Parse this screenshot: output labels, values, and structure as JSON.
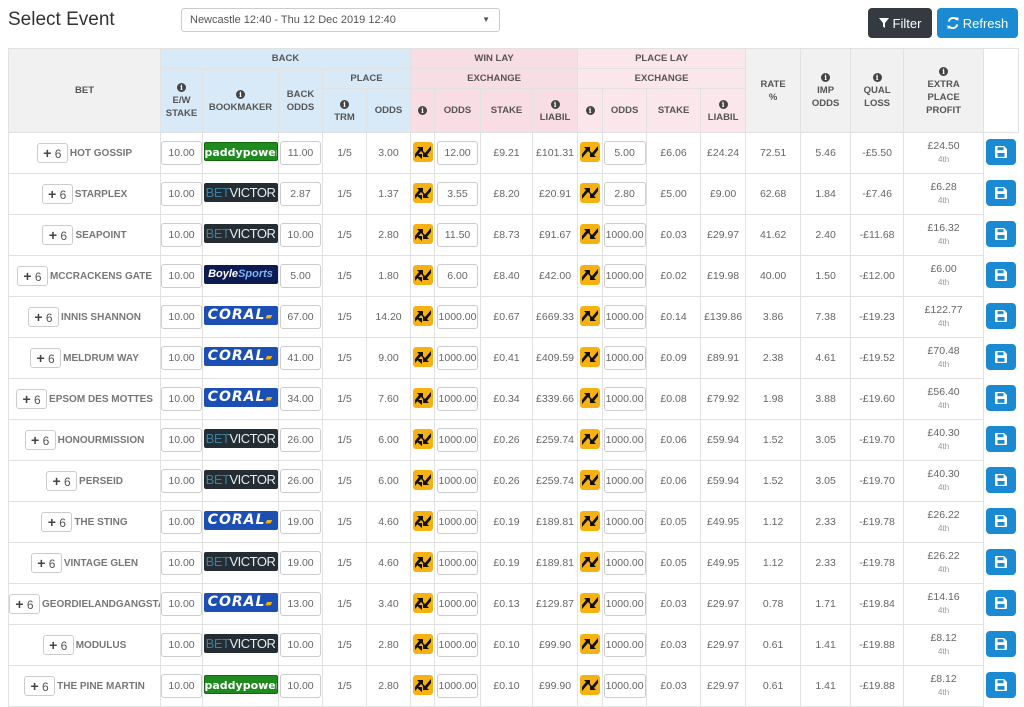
{
  "header": {
    "title": "Select Event",
    "event_select_value": "Newcastle 12:40 - Thu 12 Dec 2019 12:40",
    "filter_label": "Filter",
    "refresh_label": "Refresh"
  },
  "colors": {
    "back_header": "#d8eaf8",
    "win_lay_header": "#f9dde4",
    "place_lay_header": "#fbe6eb",
    "primary_button": "#1a8ad2",
    "dark_button": "#343a40",
    "swap_icon": "#f6b213"
  },
  "table": {
    "groups": {
      "back": "BACK",
      "place": "PLACE",
      "win_lay": "WIN LAY",
      "place_lay": "PLACE LAY",
      "exchange": "EXCHANGE"
    },
    "columns": {
      "bet": "BET",
      "ew_stake_1": "E/W",
      "ew_stake_2": "STAKE",
      "bookmaker": "BOOKMAKER",
      "back_odds_1": "BACK",
      "back_odds_2": "ODDS",
      "trm": "TRM",
      "odds": "ODDS",
      "stake": "STAKE",
      "liabil": "LIABIL",
      "rate_1": "RATE",
      "rate_2": "%",
      "imp_1": "IMP",
      "imp_2": "ODDS",
      "qual_1": "QUAL",
      "qual_2": "LOSS",
      "extra_1": "EXTRA",
      "extra_2": "PLACE",
      "extra_3": "PROFIT"
    },
    "info_glyph": "i",
    "rows": [
      {
        "places": "6",
        "horse": "HOT GOSSIP",
        "ew_stake": "10.00",
        "bookmaker": "paddypower",
        "back_odds": "11.00",
        "trm": "1/5",
        "place_odds": "3.00",
        "win_lay_odds": "12.00",
        "win_lay_stake": "£9.21",
        "win_lay_liabil": "£101.31",
        "place_lay_odds": "5.00",
        "place_lay_stake": "£6.06",
        "place_lay_liabil": "£24.24",
        "rate": "72.51",
        "imp_odds": "5.46",
        "qual_loss": "-£5.50",
        "extra_profit": "£24.50",
        "extra_place": "4th"
      },
      {
        "places": "6",
        "horse": "STARPLEX",
        "ew_stake": "10.00",
        "bookmaker": "betvictor",
        "back_odds": "2.87",
        "trm": "1/5",
        "place_odds": "1.37",
        "win_lay_odds": "3.55",
        "win_lay_stake": "£8.20",
        "win_lay_liabil": "£20.91",
        "place_lay_odds": "2.80",
        "place_lay_stake": "£5.00",
        "place_lay_liabil": "£9.00",
        "rate": "62.68",
        "imp_odds": "1.84",
        "qual_loss": "-£7.46",
        "extra_profit": "£6.28",
        "extra_place": "4th"
      },
      {
        "places": "6",
        "horse": "SEAPOINT",
        "ew_stake": "10.00",
        "bookmaker": "betvictor",
        "back_odds": "10.00",
        "trm": "1/5",
        "place_odds": "2.80",
        "win_lay_odds": "11.50",
        "win_lay_stake": "£8.73",
        "win_lay_liabil": "£91.67",
        "place_lay_odds": "1000.00",
        "place_lay_stake": "£0.03",
        "place_lay_liabil": "£29.97",
        "rate": "41.62",
        "imp_odds": "2.40",
        "qual_loss": "-£11.68",
        "extra_profit": "£16.32",
        "extra_place": "4th"
      },
      {
        "places": "6",
        "horse": "MCCRACKENS GATE",
        "ew_stake": "10.00",
        "bookmaker": "boylesports",
        "back_odds": "5.00",
        "trm": "1/5",
        "place_odds": "1.80",
        "win_lay_odds": "6.00",
        "win_lay_stake": "£8.40",
        "win_lay_liabil": "£42.00",
        "place_lay_odds": "1000.00",
        "place_lay_stake": "£0.02",
        "place_lay_liabil": "£19.98",
        "rate": "40.00",
        "imp_odds": "1.50",
        "qual_loss": "-£12.00",
        "extra_profit": "£6.00",
        "extra_place": "4th"
      },
      {
        "places": "6",
        "horse": "INNIS SHANNON",
        "ew_stake": "10.00",
        "bookmaker": "coral",
        "back_odds": "67.00",
        "trm": "1/5",
        "place_odds": "14.20",
        "win_lay_odds": "1000.00",
        "win_lay_stake": "£0.67",
        "win_lay_liabil": "£669.33",
        "place_lay_odds": "1000.00",
        "place_lay_stake": "£0.14",
        "place_lay_liabil": "£139.86",
        "rate": "3.86",
        "imp_odds": "7.38",
        "qual_loss": "-£19.23",
        "extra_profit": "£122.77",
        "extra_place": "4th"
      },
      {
        "places": "6",
        "horse": "MELDRUM WAY",
        "ew_stake": "10.00",
        "bookmaker": "coral",
        "back_odds": "41.00",
        "trm": "1/5",
        "place_odds": "9.00",
        "win_lay_odds": "1000.00",
        "win_lay_stake": "£0.41",
        "win_lay_liabil": "£409.59",
        "place_lay_odds": "1000.00",
        "place_lay_stake": "£0.09",
        "place_lay_liabil": "£89.91",
        "rate": "2.38",
        "imp_odds": "4.61",
        "qual_loss": "-£19.52",
        "extra_profit": "£70.48",
        "extra_place": "4th"
      },
      {
        "places": "6",
        "horse": "EPSOM DES MOTTES",
        "ew_stake": "10.00",
        "bookmaker": "coral",
        "back_odds": "34.00",
        "trm": "1/5",
        "place_odds": "7.60",
        "win_lay_odds": "1000.00",
        "win_lay_stake": "£0.34",
        "win_lay_liabil": "£339.66",
        "place_lay_odds": "1000.00",
        "place_lay_stake": "£0.08",
        "place_lay_liabil": "£79.92",
        "rate": "1.98",
        "imp_odds": "3.88",
        "qual_loss": "-£19.60",
        "extra_profit": "£56.40",
        "extra_place": "4th"
      },
      {
        "places": "6",
        "horse": "HONOURMISSION",
        "ew_stake": "10.00",
        "bookmaker": "betvictor",
        "back_odds": "26.00",
        "trm": "1/5",
        "place_odds": "6.00",
        "win_lay_odds": "1000.00",
        "win_lay_stake": "£0.26",
        "win_lay_liabil": "£259.74",
        "place_lay_odds": "1000.00",
        "place_lay_stake": "£0.06",
        "place_lay_liabil": "£59.94",
        "rate": "1.52",
        "imp_odds": "3.05",
        "qual_loss": "-£19.70",
        "extra_profit": "£40.30",
        "extra_place": "4th"
      },
      {
        "places": "6",
        "horse": "PERSEID",
        "ew_stake": "10.00",
        "bookmaker": "betvictor",
        "back_odds": "26.00",
        "trm": "1/5",
        "place_odds": "6.00",
        "win_lay_odds": "1000.00",
        "win_lay_stake": "£0.26",
        "win_lay_liabil": "£259.74",
        "place_lay_odds": "1000.00",
        "place_lay_stake": "£0.06",
        "place_lay_liabil": "£59.94",
        "rate": "1.52",
        "imp_odds": "3.05",
        "qual_loss": "-£19.70",
        "extra_profit": "£40.30",
        "extra_place": "4th"
      },
      {
        "places": "6",
        "horse": "THE STING",
        "ew_stake": "10.00",
        "bookmaker": "coral",
        "back_odds": "19.00",
        "trm": "1/5",
        "place_odds": "4.60",
        "win_lay_odds": "1000.00",
        "win_lay_stake": "£0.19",
        "win_lay_liabil": "£189.81",
        "place_lay_odds": "1000.00",
        "place_lay_stake": "£0.05",
        "place_lay_liabil": "£49.95",
        "rate": "1.12",
        "imp_odds": "2.33",
        "qual_loss": "-£19.78",
        "extra_profit": "£26.22",
        "extra_place": "4th"
      },
      {
        "places": "6",
        "horse": "VINTAGE GLEN",
        "ew_stake": "10.00",
        "bookmaker": "betvictor",
        "back_odds": "19.00",
        "trm": "1/5",
        "place_odds": "4.60",
        "win_lay_odds": "1000.00",
        "win_lay_stake": "£0.19",
        "win_lay_liabil": "£189.81",
        "place_lay_odds": "1000.00",
        "place_lay_stake": "£0.05",
        "place_lay_liabil": "£49.95",
        "rate": "1.12",
        "imp_odds": "2.33",
        "qual_loss": "-£19.78",
        "extra_profit": "£26.22",
        "extra_place": "4th"
      },
      {
        "places": "6",
        "horse": "GEORDIELANDGANGSTA",
        "ew_stake": "10.00",
        "bookmaker": "coral",
        "back_odds": "13.00",
        "trm": "1/5",
        "place_odds": "3.40",
        "win_lay_odds": "1000.00",
        "win_lay_stake": "£0.13",
        "win_lay_liabil": "£129.87",
        "place_lay_odds": "1000.00",
        "place_lay_stake": "£0.03",
        "place_lay_liabil": "£29.97",
        "rate": "0.78",
        "imp_odds": "1.71",
        "qual_loss": "-£19.84",
        "extra_profit": "£14.16",
        "extra_place": "4th"
      },
      {
        "places": "6",
        "horse": "MODULUS",
        "ew_stake": "10.00",
        "bookmaker": "betvictor",
        "back_odds": "10.00",
        "trm": "1/5",
        "place_odds": "2.80",
        "win_lay_odds": "1000.00",
        "win_lay_stake": "£0.10",
        "win_lay_liabil": "£99.90",
        "place_lay_odds": "1000.00",
        "place_lay_stake": "£0.03",
        "place_lay_liabil": "£29.97",
        "rate": "0.61",
        "imp_odds": "1.41",
        "qual_loss": "-£19.88",
        "extra_profit": "£8.12",
        "extra_place": "4th"
      },
      {
        "places": "6",
        "horse": "THE PINE MARTIN",
        "ew_stake": "10.00",
        "bookmaker": "paddypower",
        "back_odds": "10.00",
        "trm": "1/5",
        "place_odds": "2.80",
        "win_lay_odds": "1000.00",
        "win_lay_stake": "£0.10",
        "win_lay_liabil": "£99.90",
        "place_lay_odds": "1000.00",
        "place_lay_stake": "£0.03",
        "place_lay_liabil": "£29.97",
        "rate": "0.61",
        "imp_odds": "1.41",
        "qual_loss": "-£19.88",
        "extra_profit": "£8.12",
        "extra_place": "4th"
      }
    ]
  },
  "bookmaker_logos": {
    "paddypower": {
      "text": "paddypower"
    },
    "betvictor": {
      "text_a": "BET",
      "text_b": "VICTOR"
    },
    "boylesports": {
      "text_a": "Boyle",
      "text_b": "Sports"
    },
    "coral": {
      "text": "CORAL",
      "flag": "▰"
    }
  },
  "icons": {
    "filter": "filter-icon",
    "refresh": "refresh-icon",
    "swap": "swap-odds-icon",
    "save": "save-icon",
    "plus": "plus-icon",
    "info": "info-icon",
    "caret": "▼"
  }
}
